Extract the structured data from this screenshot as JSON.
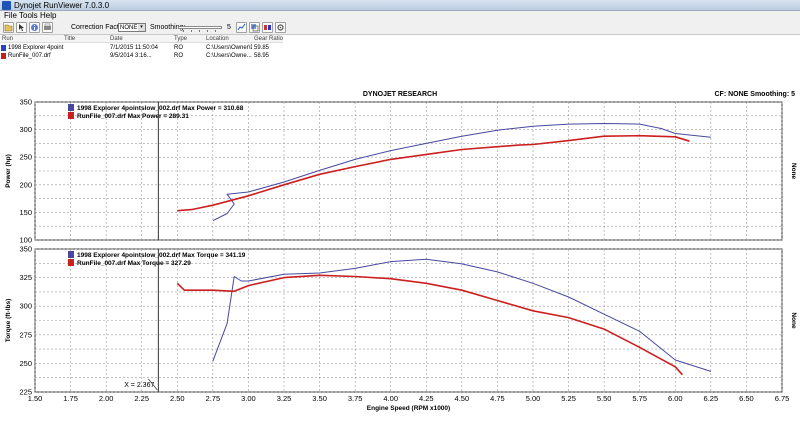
{
  "window": {
    "title": "Dynojet RunViewer 7.0.3.0"
  },
  "menu": [
    "File",
    "Tools",
    "Help"
  ],
  "toolbar": {
    "correction_label": "Correction Factor:",
    "correction_value": "NONE",
    "smoothing_label": "Smoothing:",
    "smoothing_value": "5"
  },
  "runs": {
    "headers": [
      "Run",
      "Title",
      "Date",
      "Type",
      "Location",
      "Gear Ratio"
    ],
    "rows": [
      {
        "run": "1998 Explorer 4point:",
        "title": "",
        "date": "7/1/2015 11:50:04",
        "type": "RO",
        "location": "C:\\Users\\Owner\\D",
        "gear": "59.85",
        "color": "#2b3fc7"
      },
      {
        "run": "RunFile_007.drf",
        "title": "",
        "date": "9/5/2014 3:16...",
        "type": "RO",
        "location": "C:\\Users\\Owne...",
        "gear": "58.95",
        "color": "#c81e1e"
      }
    ]
  },
  "header": {
    "company": "DYNOJET RESEARCH",
    "status": "CF: NONE  Smoothing: 5"
  },
  "chart_data": [
    {
      "type": "line",
      "title": "",
      "ylabel": "Power (hp)",
      "right_label": "None",
      "ylim": [
        100,
        350
      ],
      "yticks": [
        100,
        150,
        200,
        250,
        300,
        350
      ],
      "xlim": [
        1.5,
        6.75
      ],
      "legend": [
        "1998 Explorer 4pointslow_002.drf Max Power = 310.68",
        "RunFile_007.drf Max Power = 289.31"
      ],
      "series": [
        {
          "color": "#4848a0",
          "x": [
            2.75,
            2.85,
            2.9,
            2.85,
            3.0,
            3.25,
            3.5,
            3.75,
            4.0,
            4.25,
            4.5,
            4.75,
            5.0,
            5.25,
            5.5,
            5.75,
            5.9,
            6.0,
            6.25
          ],
          "y": [
            135,
            148,
            165,
            183,
            187,
            205,
            226,
            246,
            262,
            275,
            288,
            299,
            306,
            310,
            311,
            310,
            302,
            293,
            286
          ]
        },
        {
          "color": "#cc1f1f",
          "x": [
            2.5,
            2.6,
            2.75,
            3.0,
            3.25,
            3.5,
            3.75,
            4.0,
            4.25,
            4.5,
            4.75,
            4.9,
            5.0,
            5.25,
            5.5,
            5.75,
            6.0,
            6.1
          ],
          "y": [
            153,
            155,
            163,
            180,
            200,
            219,
            233,
            246,
            255,
            264,
            269,
            272,
            273,
            280,
            288,
            289,
            287,
            279
          ]
        }
      ]
    },
    {
      "type": "line",
      "title": "",
      "ylabel": "Torque (ft-lbs)",
      "right_label": "None",
      "xlabel": "Engine Speed (RPM x1000)",
      "ylim": [
        225,
        350
      ],
      "yticks": [
        225,
        250,
        275,
        300,
        325,
        350
      ],
      "xlim": [
        1.5,
        6.75
      ],
      "xticks": [
        "1.50",
        "1.75",
        "2.00",
        "2.25",
        "2.50",
        "2.75",
        "3.00",
        "3.25",
        "3.50",
        "3.75",
        "4.00",
        "4.25",
        "4.50",
        "4.75",
        "5.00",
        "5.25",
        "5.50",
        "5.75",
        "6.00",
        "6.25",
        "6.50",
        "6.75"
      ],
      "cursor": {
        "x": 2.367,
        "label": "X = 2.367"
      },
      "legend": [
        "1998 Explorer 4pointslow_002.drf Max Torque = 341.19",
        "RunFile_007.drf Max Torque = 327.29"
      ],
      "series": [
        {
          "color": "#4848a0",
          "x": [
            2.75,
            2.85,
            2.9,
            2.95,
            3.0,
            3.25,
            3.5,
            3.75,
            4.0,
            4.25,
            4.5,
            4.75,
            5.0,
            5.25,
            5.5,
            5.75,
            6.0,
            6.25
          ],
          "y": [
            252,
            285,
            326,
            322,
            322,
            328,
            329,
            333,
            339,
            341,
            337,
            330,
            320,
            308,
            293,
            278,
            253,
            243
          ]
        },
        {
          "color": "#cc1f1f",
          "x": [
            2.5,
            2.55,
            2.75,
            2.9,
            3.0,
            3.25,
            3.5,
            3.75,
            4.0,
            4.25,
            4.5,
            4.75,
            5.0,
            5.25,
            5.5,
            5.75,
            6.0,
            6.05
          ],
          "y": [
            320,
            314,
            314,
            313,
            318,
            325,
            327,
            326,
            324,
            320,
            314,
            305,
            296,
            290,
            280,
            264,
            247,
            240
          ]
        }
      ]
    }
  ]
}
